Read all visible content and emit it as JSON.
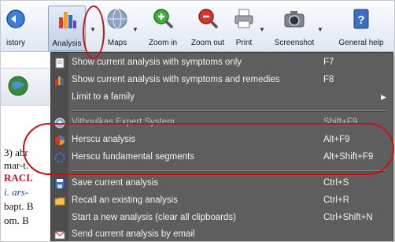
{
  "toolbar": {
    "history_label": "istory",
    "analysis_label": "Analysis",
    "maps_label": "Maps",
    "zoom_in_label": "Zoom in",
    "zoom_out_label": "Zoom out",
    "print_label": "Print",
    "screenshot_label": "Screenshot",
    "help_label": "General help"
  },
  "leftpane": {
    "lines": [
      "3) abr",
      "mar-t.",
      "RACI.",
      "i. ars-",
      "bapt. B",
      "om. B"
    ]
  },
  "menu": {
    "items": [
      {
        "label": "Show current analysis with symptoms only",
        "shortcut": "F7"
      },
      {
        "label": "Show current analysis with symptoms and remedies",
        "shortcut": "F8"
      },
      {
        "label": "Limit to a family",
        "shortcut": ""
      },
      {
        "label": "Vithoulkas Expert System",
        "shortcut": "Shift+F9"
      },
      {
        "label": "Herscu analysis",
        "shortcut": "Alt+F9"
      },
      {
        "label": "Herscu fundamental segments",
        "shortcut": "Alt+Shift+F9"
      },
      {
        "label": "Save current analysis",
        "shortcut": "Ctrl+S"
      },
      {
        "label": "Recall an existing analysis",
        "shortcut": "Ctrl+R"
      },
      {
        "label": "Start a new analysis (clear all clipboards)",
        "shortcut": "Ctrl+Shift+N"
      },
      {
        "label": "Send current analysis by email",
        "shortcut": ""
      }
    ]
  },
  "colors": {
    "menu_bg": "#5e5e5e",
    "menu_text": "#f2f2f2",
    "highlight_circle": "#c4121a"
  }
}
